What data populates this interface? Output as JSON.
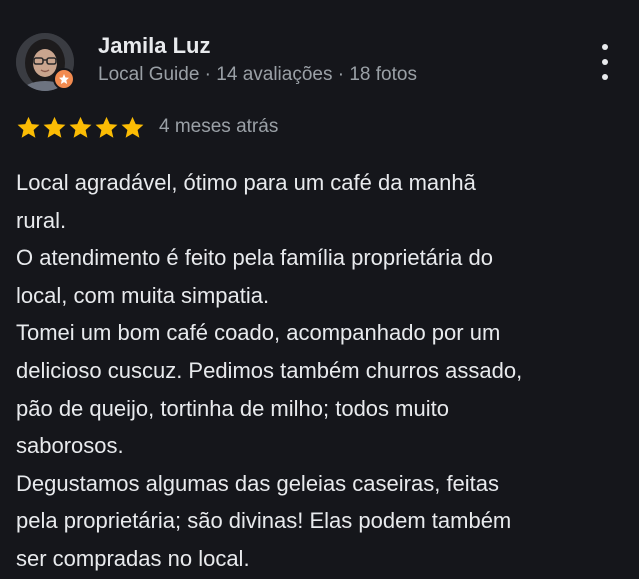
{
  "review": {
    "author": {
      "name": "Jamila Luz",
      "meta": "Local Guide · 14 avaliações · 18 fotos"
    },
    "rating": 5,
    "date": "4 meses atrás",
    "lines": [
      "Local agradável, ótimo para um café da manhã",
      "rural.",
      "O atendimento é feito pela família proprietária do",
      "local, com muita simpatia.",
      "Tomei um bom café coado, acompanhado por um",
      "delicioso cuscuz. Pedimos também churros assado,",
      "pão de queijo, tortinha de milho; todos muito",
      "saborosos.",
      "Degustamos algumas das geleias caseiras, feitas",
      "pela proprietária; são divinas! Elas podem também",
      "ser compradas no local."
    ]
  },
  "icons": {
    "avatar": "user-photo",
    "badge": "local-guide-star-icon",
    "menu": "more-vertical-icon",
    "rating": "star-icon"
  },
  "colors": {
    "background": "#15161b",
    "text": "#e8eaed",
    "secondary_text": "#9aa0a6",
    "star": "#fbbc04",
    "guide_badge": "#f28b50"
  }
}
